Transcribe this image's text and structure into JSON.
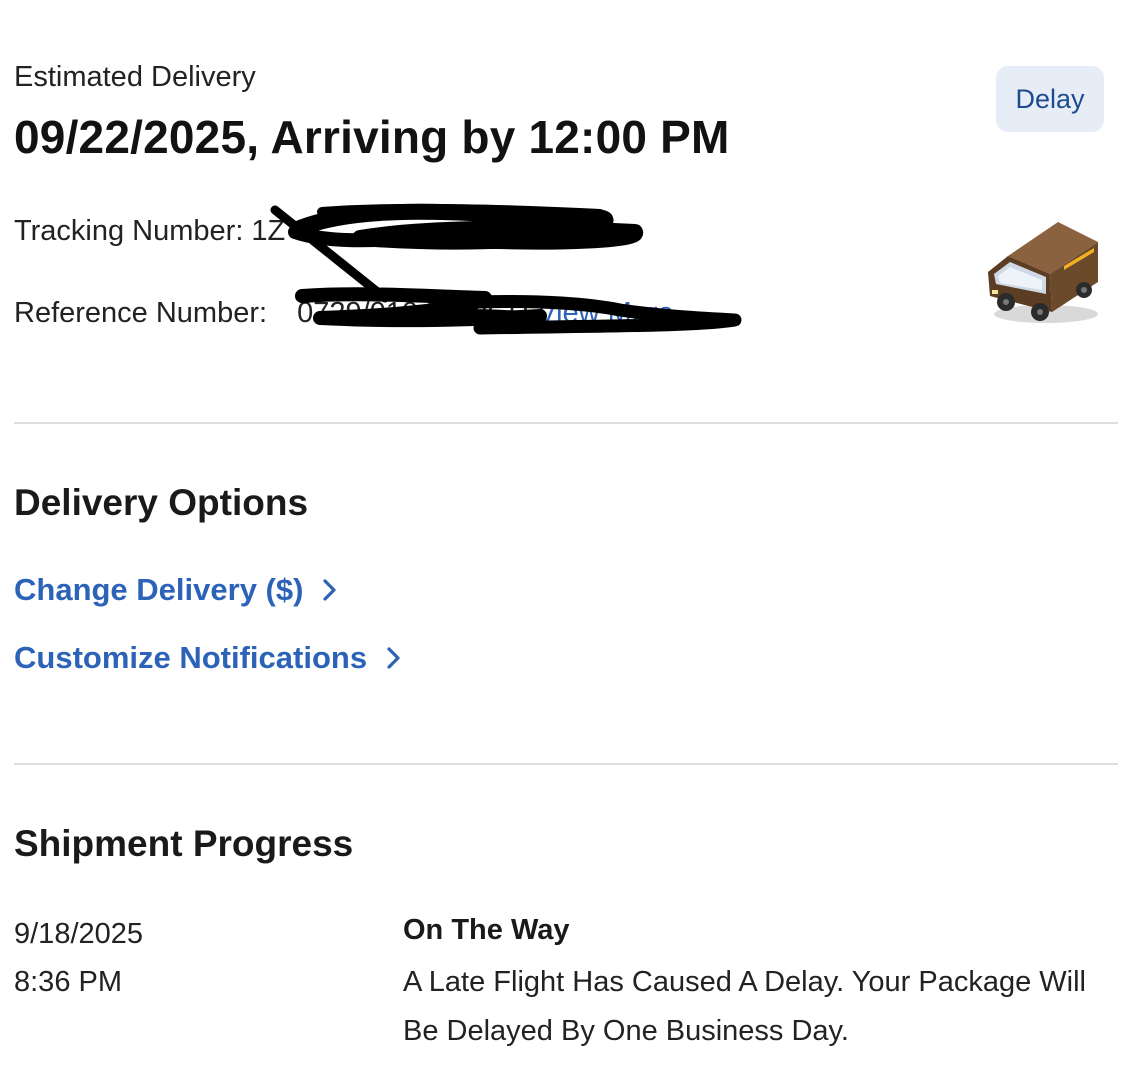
{
  "estimated_delivery": {
    "label": "Estimated Delivery",
    "value": "09/22/2025, Arriving by 12:00 PM",
    "status_badge": "Delay"
  },
  "tracking": {
    "label": "Tracking Number:",
    "value": "1Z"
  },
  "reference": {
    "label": "Reference Number:",
    "value": "0729/010 DHPCR",
    "view_more": "View More"
  },
  "delivery_options": {
    "title": "Delivery Options",
    "links": [
      {
        "label": "Change Delivery ($)",
        "icon": "chevron-right-icon"
      },
      {
        "label": "Customize Notifications",
        "icon": "chevron-right-icon"
      }
    ]
  },
  "shipment_progress": {
    "title": "Shipment Progress",
    "events": [
      {
        "date": "9/18/2025",
        "time": "8:36 PM",
        "status": "On The Way",
        "description": "A Late Flight Has Caused A Delay. Your Package Will Be Delayed By One Business Day."
      }
    ]
  },
  "icons": {
    "truck": "delivery-truck-icon",
    "chevron": "chevron-right-icon"
  },
  "colors": {
    "link": "#2c63b8",
    "badge_bg": "#e6edf7",
    "badge_text": "#1e4b8e",
    "divider": "#dedede",
    "truck_brown": "#6b4a2b",
    "truck_gold": "#f2b01e"
  }
}
